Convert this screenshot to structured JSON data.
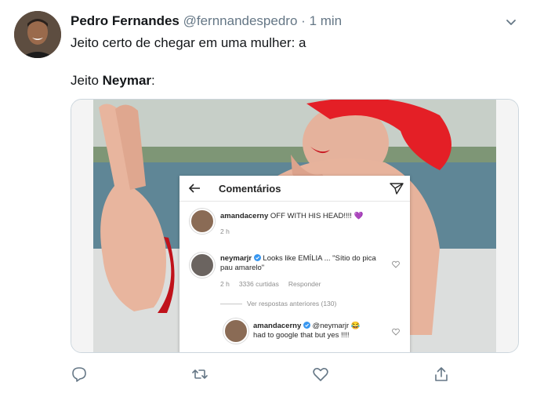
{
  "tweet": {
    "author_name": "Pedro Fernandes",
    "author_handle": "@fernnandespedro",
    "separator": "·",
    "timestamp": "1 min",
    "line1": "Jeito certo de chegar em uma mulher: a",
    "line2_prefix": "Jeito ",
    "line2_bold": "Neymar",
    "line2_suffix": ":"
  },
  "comments_card": {
    "title": "Comentários",
    "comment1": {
      "user": "amandacerny",
      "text": " OFF WITH HIS HEAD!!!! 💜",
      "time": "2 h"
    },
    "comment2": {
      "user": "neymarjr",
      "text": " Looks like EMÍLIA ... \"Sítio do pica pau amarelo\"",
      "time": "2 h",
      "likes": "3336 curtidas",
      "reply": "Responder"
    },
    "view_previous": "Ver respostas anteriores (130)",
    "comment3": {
      "user": "amandacerny",
      "mention": " @neymarjr 😂",
      "text": "had to google that but yes !!!!"
    }
  },
  "colors": {
    "secondary_text": "#657786",
    "border": "#ccd6dd",
    "verified": "#3897f0"
  }
}
